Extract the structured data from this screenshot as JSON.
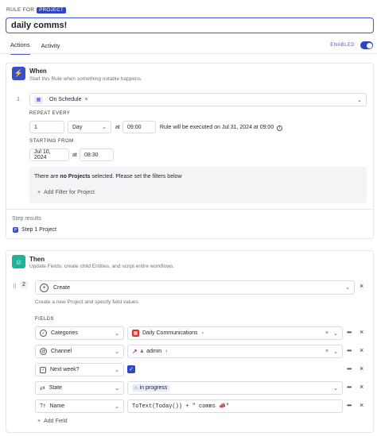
{
  "header": {
    "rule_for_label": "RULE FOR",
    "entity_badge": "PROJECT",
    "rule_title": "daily comms!"
  },
  "tabs": [
    {
      "label": "Actions"
    },
    {
      "label": "Activity"
    }
  ],
  "status": {
    "enabled_label": "ENABLED"
  },
  "when": {
    "title": "When",
    "subtitle": "Start this Rule when something notable happens.",
    "step_number": "1",
    "trigger_label": "On Schedule",
    "repeat_every_label": "REPEAT EVERY",
    "repeat_value": "1",
    "repeat_unit": "Day",
    "at_label": "at",
    "repeat_time": "09:00",
    "next_run_text": "Rule will be executed on Jul 31, 2024 at 09:00",
    "starting_from_label": "STARTING FROM",
    "start_date": "Jul 10, 2024",
    "start_time": "08:30",
    "filter_notice": {
      "prefix": "There are ",
      "bold": "no Projects",
      "suffix": " selected. Please set the filters below"
    },
    "add_filter_label": "Add Filter for Project",
    "step_results_label": "Step results",
    "step_result_item": "Step 1 Project"
  },
  "then": {
    "title": "Then",
    "subtitle": "Update Fields, create child Entities, and script entire workflows.",
    "step_number": "2",
    "action_label": "Create",
    "action_hint": "Create a new Project and specify field values",
    "fields_label": "FIELDS",
    "fields": [
      {
        "name": "Categories",
        "value": "Daily Communications"
      },
      {
        "name": "Channel",
        "value": "admin"
      },
      {
        "name": "Next week?",
        "value": "checked"
      },
      {
        "name": "State",
        "value": "in progress"
      },
      {
        "name": "Name",
        "value": "ToText(Today()) + \" comms 📣\""
      }
    ],
    "add_field_label": "Add Field"
  },
  "colors": {
    "accent": "#2f47c4",
    "when_icon": "#3d4fc6",
    "then_icon": "#1fb39a",
    "categories_icon": "#e03131",
    "channel_icon": "#d6336c"
  }
}
